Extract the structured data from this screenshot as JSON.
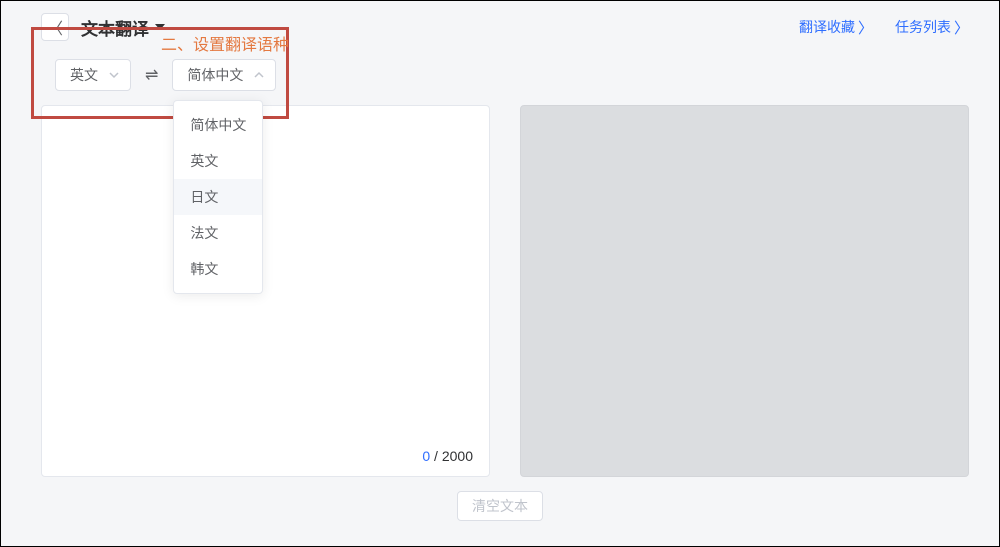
{
  "header": {
    "title": "文本翻译",
    "annotation": "二、设置翻译语种",
    "links": {
      "favorites": "翻译收藏",
      "tasks": "任务列表"
    }
  },
  "languages": {
    "source": "英文",
    "target": "简体中文",
    "options": [
      "简体中文",
      "英文",
      "日文",
      "法文",
      "韩文"
    ],
    "hovered_index": 2
  },
  "counter": {
    "current": "0",
    "max": "2000"
  },
  "footer": {
    "clear": "清空文本"
  }
}
